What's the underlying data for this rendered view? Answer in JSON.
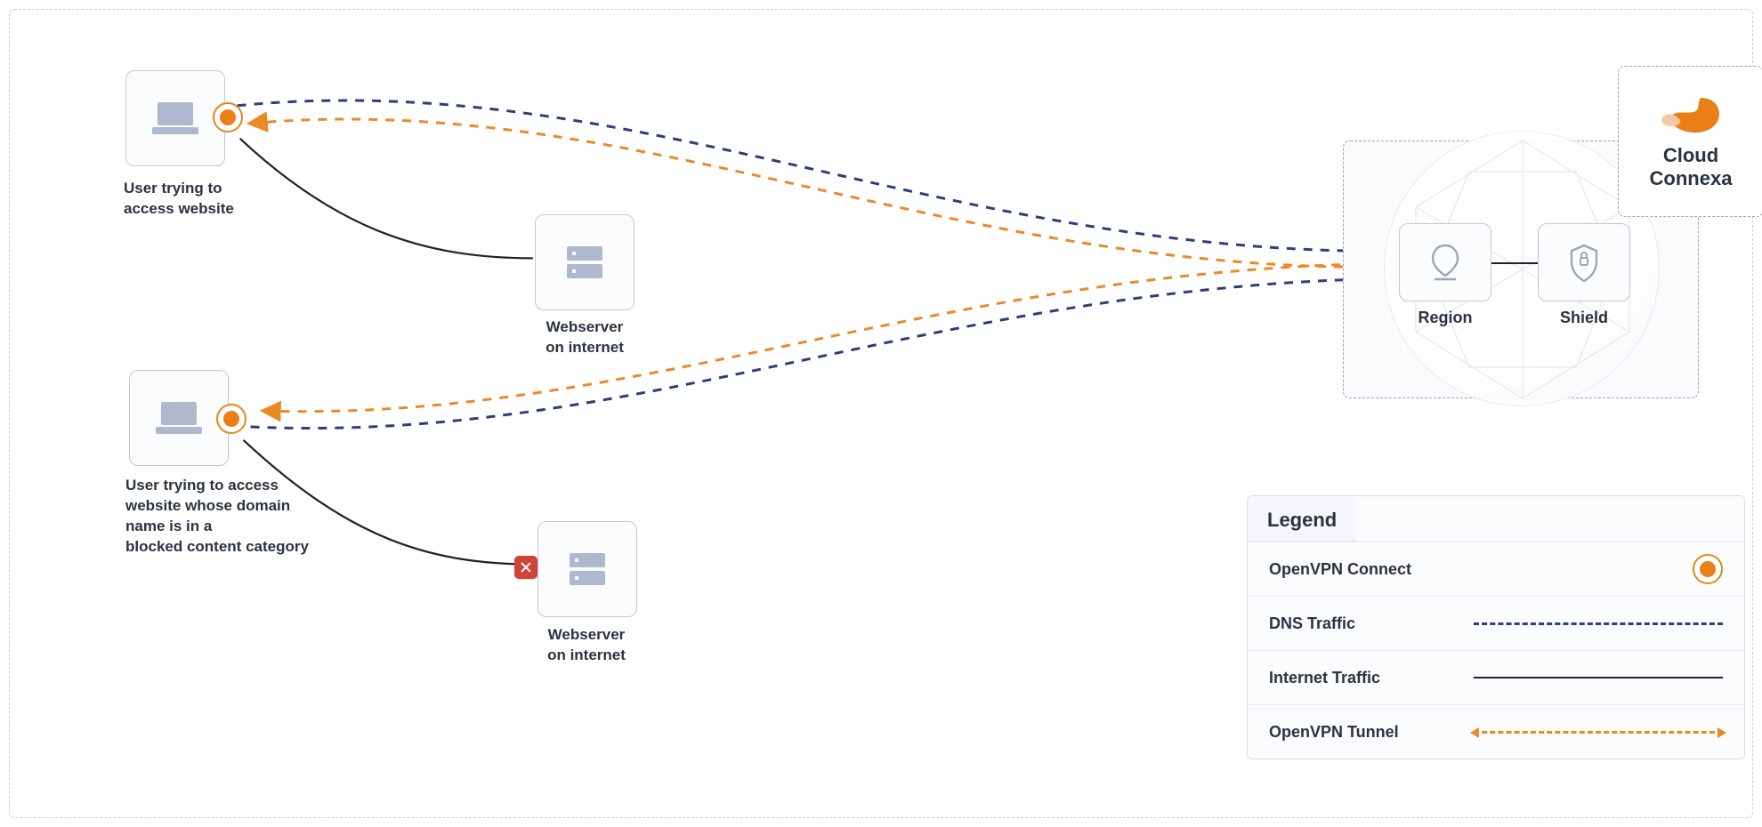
{
  "user1": {
    "label": "User trying to\naccess website"
  },
  "user2": {
    "label": "User trying to access\nwebsite whose domain\nname is in a\nblocked content category"
  },
  "webserver1": {
    "label": "Webserver\non internet"
  },
  "webserver2": {
    "label": "Webserver\non internet"
  },
  "region": {
    "label": "Region"
  },
  "shield": {
    "label": "Shield"
  },
  "brand": {
    "label": "Cloud\nConnexa"
  },
  "legend": {
    "title": "Legend",
    "rows": {
      "connect": "OpenVPN Connect",
      "dns": "DNS Traffic",
      "internet": "Internet Traffic",
      "tunnel": "OpenVPN Tunnel"
    }
  }
}
